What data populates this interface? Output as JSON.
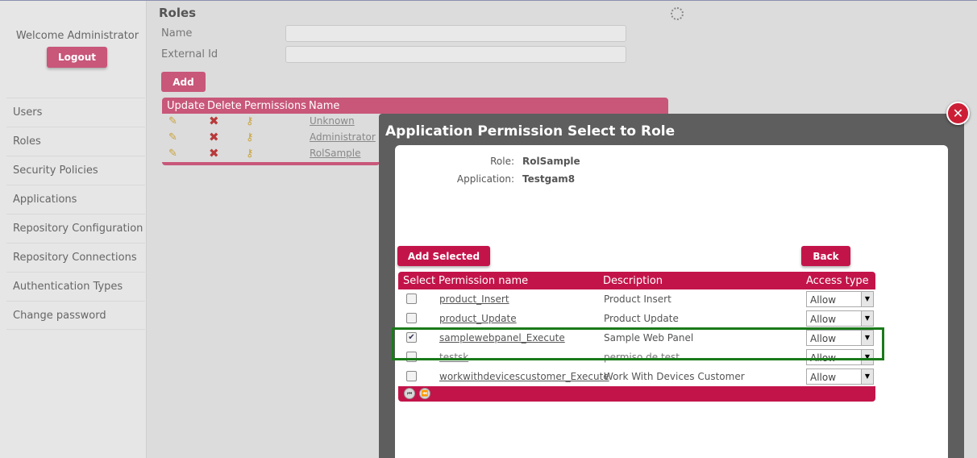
{
  "sidebar": {
    "welcome": "Welcome Administrator",
    "logout_label": "Logout",
    "items": [
      {
        "label": "Users"
      },
      {
        "label": "Roles"
      },
      {
        "label": "Security Policies"
      },
      {
        "label": "Applications"
      },
      {
        "label": "Repository Configuration"
      },
      {
        "label": "Repository Connections"
      },
      {
        "label": "Authentication Types"
      },
      {
        "label": "Change password"
      }
    ]
  },
  "roles": {
    "title": "Roles",
    "name_label": "Name",
    "external_id_label": "External Id",
    "name_value": "",
    "external_id_value": "",
    "add_label": "Add",
    "columns": [
      "Update",
      "Delete",
      "Permissions",
      "Name"
    ],
    "rows": [
      {
        "name": "Unknown"
      },
      {
        "name": "Administrator"
      },
      {
        "name": "RolSample"
      }
    ]
  },
  "icons": {
    "update": "pencil-icon",
    "delete": "delete-x-icon",
    "permissions": "key-icon",
    "close": "close-icon",
    "loading": "loading-spinner-icon"
  },
  "popup": {
    "title": "Application Permission Select to Role",
    "close_glyph": "✕",
    "role_label": "Role:",
    "role_value": "RolSample",
    "application_label": "Application:",
    "application_value": "Testgam8",
    "add_selected_label": "Add Selected",
    "back_label": "Back",
    "columns": [
      "Select",
      "Permission name",
      "Description",
      "Access type"
    ],
    "rows": [
      {
        "checked": false,
        "name": "product_Insert",
        "description": "Product Insert",
        "access": "Allow"
      },
      {
        "checked": false,
        "name": "product_Update",
        "description": "Product Update",
        "access": "Allow"
      },
      {
        "checked": true,
        "name": "samplewebpanel_Execute",
        "description": "Sample Web Panel",
        "access": "Allow"
      },
      {
        "checked": false,
        "name": "testsk",
        "description": "permiso de test",
        "access": "Allow"
      },
      {
        "checked": false,
        "name": "workwithdevicescustomer_Execute",
        "description": "Work With Devices Customer",
        "access": "Allow"
      }
    ]
  },
  "colors": {
    "accent": "#c8577a",
    "popup_accent": "#c3144a",
    "highlight": "#1a7a1a",
    "close": "#cc1f36"
  }
}
